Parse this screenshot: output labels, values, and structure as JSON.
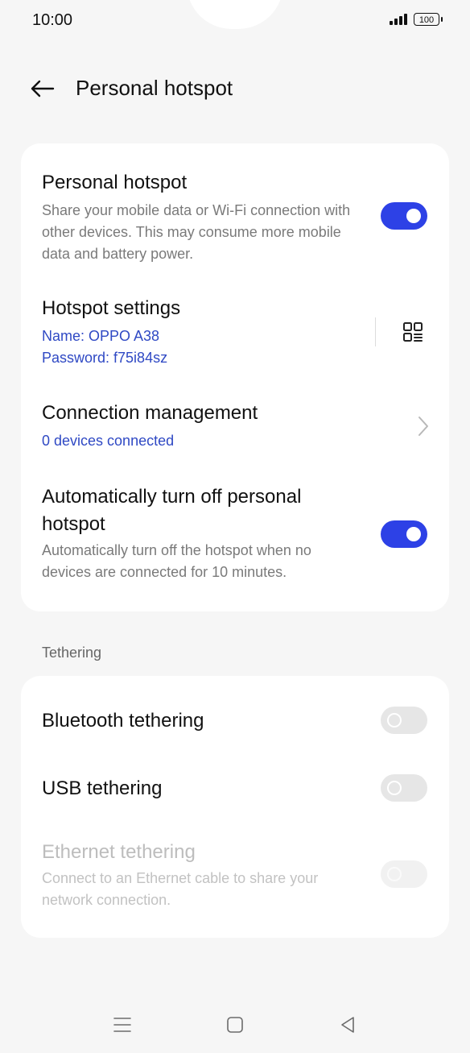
{
  "status_bar": {
    "time": "10:00",
    "battery": "100"
  },
  "header": {
    "title": "Personal hotspot"
  },
  "hotspot": {
    "title": "Personal hotspot",
    "description": "Share your mobile data or Wi-Fi connection with other devices. This may consume more mobile data and battery power.",
    "enabled": true
  },
  "hotspot_settings": {
    "title": "Hotspot settings",
    "name": "Name: OPPO A38",
    "password": "Password: f75i84sz"
  },
  "connection_management": {
    "title": "Connection management",
    "status": "0 devices connected"
  },
  "auto_off": {
    "title_line1": "Automatically turn off personal",
    "title_line2": "hotspot",
    "description": "Automatically turn off the hotspot when no devices are connected for 10 minutes.",
    "enabled": true
  },
  "tethering": {
    "section_label": "Tethering",
    "bluetooth": {
      "label": "Bluetooth tethering",
      "enabled": false
    },
    "usb": {
      "label": "USB tethering",
      "enabled": false
    },
    "ethernet": {
      "label": "Ethernet tethering",
      "description": "Connect to an Ethernet cable to share your network connection.",
      "enabled": false,
      "available": false
    }
  },
  "colors": {
    "accent": "#2d41e6",
    "link": "#2f49c4",
    "background": "#f6f6f6",
    "card": "#ffffff"
  },
  "icons": {
    "back": "arrow-left-icon",
    "qr": "qr-code-icon",
    "chevron": "chevron-right-icon",
    "nav_menu": "menu-icon",
    "nav_home": "home-icon",
    "nav_back": "back-triangle-icon"
  }
}
